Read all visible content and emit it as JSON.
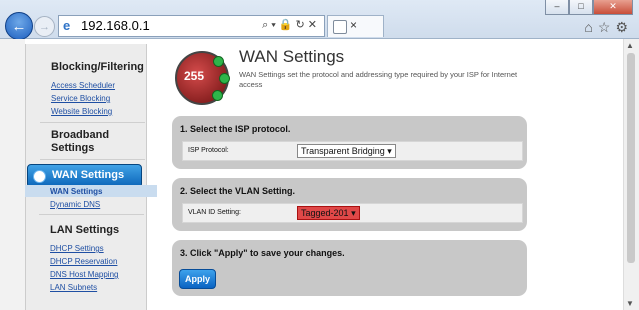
{
  "browser": {
    "address": "192.168.0.1",
    "tab_close": "×",
    "window_buttons": {
      "minimize": "–",
      "maximize": "□",
      "close": "✕"
    }
  },
  "sidebar": {
    "sections": [
      {
        "heading": "Blocking/Filtering",
        "links": [
          "Access Scheduler",
          "Service Blocking",
          "Website Blocking"
        ]
      },
      {
        "heading": "Broadband Settings",
        "links": []
      },
      {
        "heading": "WAN Settings",
        "links": [
          "WAN Settings",
          "Dynamic DNS"
        ],
        "active": true
      },
      {
        "heading": "LAN Settings",
        "links": [
          "DHCP Settings",
          "DHCP Reservation",
          "DNS Host Mapping",
          "LAN Subnets"
        ]
      }
    ]
  },
  "main": {
    "logo_text": "255",
    "title": "WAN Settings",
    "description": "WAN Settings set the protocol and addressing type required by your ISP for Internet access",
    "isp": {
      "heading": "1. Select the ISP protocol.",
      "label": "ISP Protocol:",
      "value": "Transparent Bridging"
    },
    "vlan": {
      "heading": "2. Select the VLAN Setting.",
      "label": "VLAN ID Setting:",
      "value": "Tagged-201"
    },
    "apply": {
      "heading": "3. Click \"Apply\" to save your changes.",
      "button": "Apply"
    }
  },
  "colors": {
    "accent": "#0a64b8",
    "vlan_select": "#e04848",
    "panel": "#c8c8c8"
  }
}
